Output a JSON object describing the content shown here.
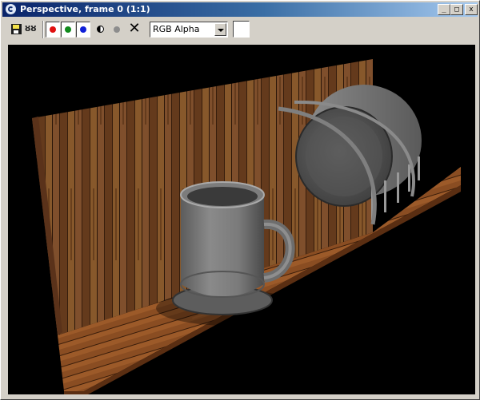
{
  "window": {
    "title": "Perspective, frame 0 (1:1)",
    "controls": {
      "minimize": "_",
      "maximize": "□",
      "close": "x"
    }
  },
  "toolbar": {
    "save_icon": "save-disk-icon",
    "clone_icon": "clone-window-icon",
    "clone_glyph": "ȣȣ",
    "channels": [
      {
        "name": "red-channel",
        "color": "#e01010"
      },
      {
        "name": "green-channel",
        "color": "#118a1c"
      },
      {
        "name": "blue-channel",
        "color": "#1020d8"
      }
    ],
    "monochrome_icon": "half-circle-icon",
    "gray_dot_color": "#8d8d8d",
    "clear_glyph": "✕",
    "channel_display": {
      "selected": "RGB Alpha"
    },
    "swatch_color": "#ffffff"
  },
  "viewport": {
    "background": "#000000",
    "scene": [
      "wood-wall",
      "wood-floor",
      "mug",
      "pot-lid",
      "wire-hoops"
    ]
  }
}
